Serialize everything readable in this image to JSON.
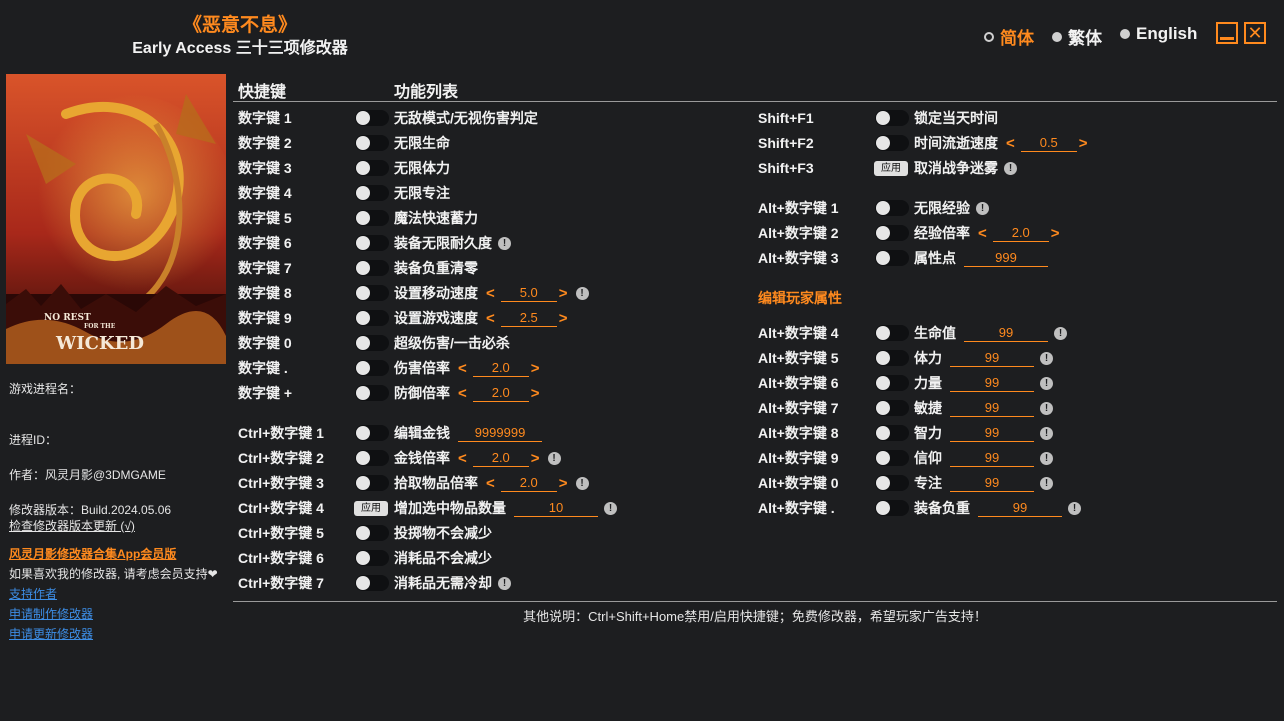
{
  "header": {
    "game_title": "《恶意不息》",
    "subtitle": "Early Access 三十三项修改器"
  },
  "languages": [
    {
      "label": "简体",
      "selected": true
    },
    {
      "label": "繁体",
      "selected": false
    },
    {
      "label": "English",
      "selected": false
    }
  ],
  "window": {
    "minimize_icon": "minimize-icon",
    "close_icon": "close-icon",
    "close_glyph": "✕"
  },
  "sidebar": {
    "process_name_label": "游戏进程名：",
    "process_id_label": "进程ID：",
    "author": "作者：风灵月影@3DMGAME",
    "version": "修改器版本：Build.2024.05.06",
    "check_update": "检查修改器版本更新 (√)",
    "promo": "风灵月影修改器合集App会员版",
    "support_note": "如果喜欢我的修改器, 请考虑会员支持❤",
    "links": [
      "支持作者",
      "申请制作修改器",
      "申请更新修改器"
    ]
  },
  "columns": {
    "hotkey": "快捷键",
    "function_list": "功能列表"
  },
  "left_features": [
    {
      "key": "数字键 1",
      "name": "无敌模式/无视伤害判定"
    },
    {
      "key": "数字键 2",
      "name": "无限生命"
    },
    {
      "key": "数字键 3",
      "name": "无限体力"
    },
    {
      "key": "数字键 4",
      "name": "无限专注"
    },
    {
      "key": "数字键 5",
      "name": "魔法快速蓄力"
    },
    {
      "key": "数字键 6",
      "name": "装备无限耐久度",
      "warn": true
    },
    {
      "key": "数字键 7",
      "name": "装备负重清零"
    },
    {
      "key": "数字键 8",
      "name": "设置移动速度",
      "value": "5.0",
      "arrows": true,
      "warn": true
    },
    {
      "key": "数字键 9",
      "name": "设置游戏速度",
      "value": "2.5",
      "arrows": true
    },
    {
      "key": "数字键 0",
      "name": "超级伤害/一击必杀"
    },
    {
      "key": "数字键 .",
      "name": "伤害倍率",
      "value": "2.0",
      "arrows": true
    },
    {
      "key": "数字键 +",
      "name": "防御倍率",
      "value": "2.0",
      "arrows": true
    },
    {
      "key": "Ctrl+数字键 1",
      "name": "编辑金钱",
      "value": "9999999"
    },
    {
      "key": "Ctrl+数字键 2",
      "name": "金钱倍率",
      "value": "2.0",
      "arrows": true,
      "warn": true
    },
    {
      "key": "Ctrl+数字键 3",
      "name": "拾取物品倍率",
      "value": "2.0",
      "arrows": true,
      "warn": true
    },
    {
      "key": "Ctrl+数字键 4",
      "name": "增加选中物品数量",
      "value": "10",
      "apply": true,
      "warn": true
    },
    {
      "key": "Ctrl+数字键 5",
      "name": "投掷物不会减少"
    },
    {
      "key": "Ctrl+数字键 6",
      "name": "消耗品不会减少"
    },
    {
      "key": "Ctrl+数字键 7",
      "name": "消耗品无需冷却",
      "warn": true
    }
  ],
  "right_features": [
    {
      "key": "Shift+F1",
      "name": "锁定当天时间"
    },
    {
      "key": "Shift+F2",
      "name": "时间流逝速度",
      "value": "0.5",
      "arrows": true
    },
    {
      "key": "Shift+F3",
      "name": "取消战争迷雾",
      "apply": true,
      "warn": true
    },
    {
      "key": "Alt+数字键 1",
      "name": "无限经验",
      "warn": true
    },
    {
      "key": "Alt+数字键 2",
      "name": "经验倍率",
      "value": "2.0",
      "arrows": true
    },
    {
      "key": "Alt+数字键 3",
      "name": "属性点",
      "value": "999"
    },
    {
      "key": "Alt+数字键 4",
      "name": "生命值",
      "value": "99",
      "warn": true
    },
    {
      "key": "Alt+数字键 5",
      "name": "体力",
      "value": "99",
      "warn": true
    },
    {
      "key": "Alt+数字键 6",
      "name": "力量",
      "value": "99",
      "warn": true
    },
    {
      "key": "Alt+数字键 7",
      "name": "敏捷",
      "value": "99",
      "warn": true
    },
    {
      "key": "Alt+数字键 8",
      "name": "智力",
      "value": "99",
      "warn": true
    },
    {
      "key": "Alt+数字键 9",
      "name": "信仰",
      "value": "99",
      "warn": true
    },
    {
      "key": "Alt+数字键 0",
      "name": "专注",
      "value": "99",
      "warn": true
    },
    {
      "key": "Alt+数字键 .",
      "name": "装备负重",
      "value": "99",
      "warn": true
    }
  ],
  "section_edit_player": "编辑玩家属性",
  "apply_label": "应用",
  "warn_glyph": "!",
  "arrow_left": "<",
  "arrow_right": ">",
  "footer": "其他说明：Ctrl+Shift+Home禁用/启用快捷键；免费修改器，希望玩家广告支持！",
  "colors": {
    "accent": "#ff8a1e",
    "background": "#1d1e20",
    "link": "#3d8ee6"
  }
}
